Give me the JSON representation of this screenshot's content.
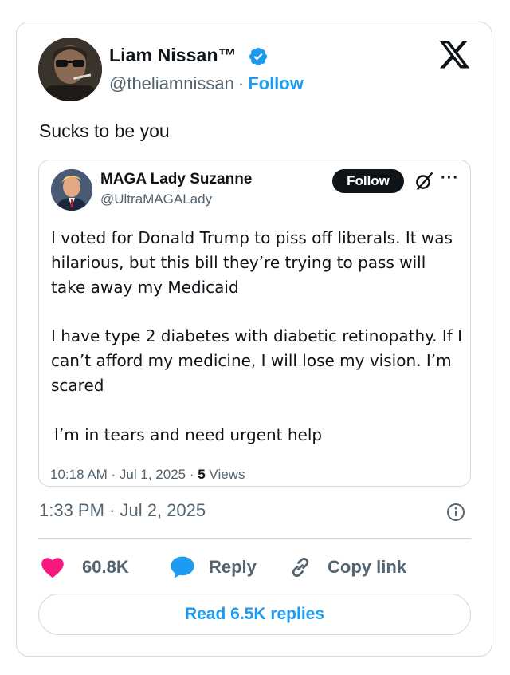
{
  "tweet": {
    "author_name": "Liam Nissan™",
    "handle": "@theliamnissan",
    "separator": "·",
    "follow_label": "Follow",
    "text": "Sucks to be you",
    "timestamp": "1:33 PM · Jul 2, 2025",
    "brand_icon": "x-logo-icon",
    "verified_icon": "verified-badge-icon"
  },
  "quoted_tweet": {
    "author_name": "MAGA Lady Suzanne",
    "handle": "@UltraMAGALady",
    "follow_label": "Follow",
    "more_label": "···",
    "paragraph1": "I voted for Donald Trump to piss off liberals. It was\nhilarious, but this bill they’re trying to pass will\ntake away my Medicaid",
    "paragraph2": "I have type 2 diabetes with diabetic retinopathy. If I\ncan’t afford my medicine, I will lose my vision. I’m\nscared",
    "paragraph3": "I’m in tears and need urgent help",
    "meta_time": "10:18 AM · Jul 1, 2025 · ",
    "views_count": "5",
    "views_label": " Views"
  },
  "actions": {
    "like_count": "60.8K",
    "reply_label": "Reply",
    "copy_label": "Copy link"
  },
  "read_replies_label": "Read 6.5K replies",
  "colors": {
    "accent": "#1d9bf0",
    "like": "#f91880",
    "text": "#0f1419",
    "muted": "#536471",
    "border": "#cfd9de"
  }
}
